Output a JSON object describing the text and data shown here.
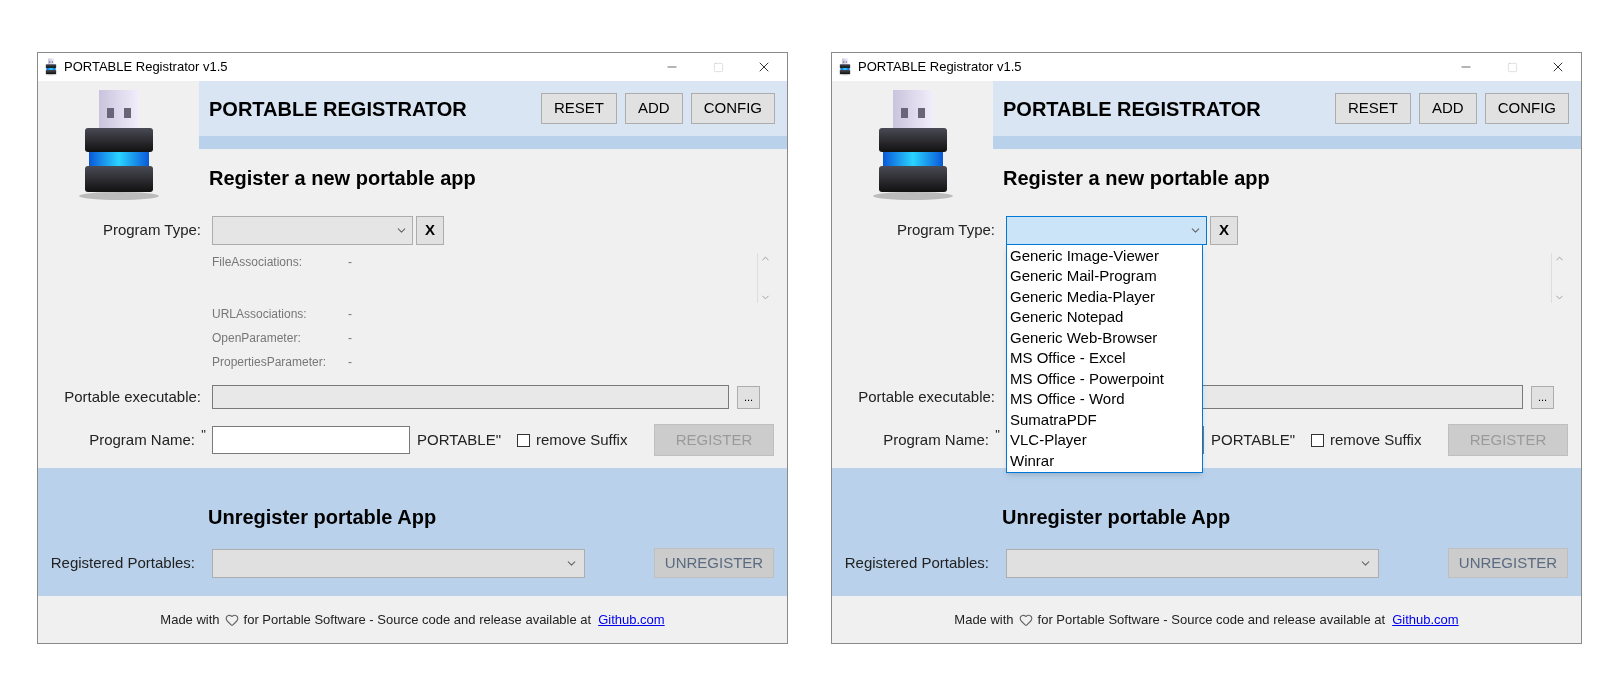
{
  "windows": [
    {
      "title": "PORTABLE Registrator v1.5",
      "header_title": "PORTABLE REGISTRATOR",
      "header_buttons": [
        "RESET",
        "ADD",
        "CONFIG"
      ],
      "section_title": "Register a new portable app",
      "program_type": {
        "label": "Program Type:",
        "expanded": false,
        "clear_label": "X"
      },
      "details": [
        {
          "kind": "list",
          "label": "FileAssociations:",
          "value": "-"
        },
        {
          "kind": "line",
          "label": "URLAssociations:",
          "value": "-"
        },
        {
          "kind": "line",
          "label": "OpenParameter:",
          "value": "-"
        },
        {
          "kind": "line",
          "label": "PropertiesParameter:",
          "value": "-"
        }
      ],
      "executable": {
        "label": "Portable executable:",
        "browse_label": "..."
      },
      "program_name": {
        "label": "Program Name:",
        "open_quote": "\"",
        "suffix": "PORTABLE\"",
        "remove_suffix": {
          "label": "remove Suffix",
          "checked": false
        }
      },
      "register": {
        "label": "REGISTER",
        "disabled": true
      },
      "unregister": {
        "title": "Unregister portable App",
        "label": "Registered Portables:",
        "button": {
          "label": "UNREGISTER",
          "disabled": true
        }
      },
      "footer": {
        "before": "Made with",
        "after": "for Portable Software - Source code and release available at",
        "link": "Github.com"
      }
    },
    {
      "title": "PORTABLE Registrator v1.5",
      "header_title": "PORTABLE REGISTRATOR",
      "header_buttons": [
        "RESET",
        "ADD",
        "CONFIG"
      ],
      "section_title": "Register a new portable app",
      "program_type": {
        "label": "Program Type:",
        "expanded": true,
        "clear_label": "X",
        "options": [
          "Generic Image-Viewer",
          "Generic Mail-Program",
          "Generic Media-Player",
          "Generic Notepad",
          "Generic Web-Browser",
          "MS Office - Excel",
          "MS Office - Powerpoint",
          "MS Office - Word",
          "SumatraPDF",
          "VLC-Player",
          "Winrar"
        ]
      },
      "executable": {
        "label": "Portable executable:",
        "browse_label": "..."
      },
      "program_name": {
        "label": "Program Name:",
        "open_quote": "\"",
        "suffix": "PORTABLE\"",
        "remove_suffix": {
          "label": "remove Suffix",
          "checked": false
        }
      },
      "register": {
        "label": "REGISTER",
        "disabled": true
      },
      "unregister": {
        "title": "Unregister portable App",
        "label": "Registered Portables:",
        "button": {
          "label": "UNREGISTER",
          "disabled": true
        }
      },
      "footer": {
        "before": "Made with",
        "after": "for Portable Software - Source code and release available at",
        "link": "Github.com"
      }
    }
  ]
}
